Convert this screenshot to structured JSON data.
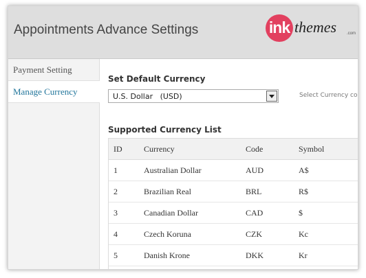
{
  "header": {
    "title": "Appointments Advance Settings",
    "logo": {
      "mark": "ink",
      "word": "themes",
      "suffix": ".com"
    }
  },
  "sidebar": {
    "items": [
      {
        "label": "Payment Setting",
        "active": false
      },
      {
        "label": "Manage Currency",
        "active": true
      }
    ]
  },
  "default_currency": {
    "heading": "Set Default Currency",
    "selected": "U.S. Dollar   (USD)",
    "hint": "Select Currency code."
  },
  "currency_list": {
    "heading": "Supported Currency List",
    "columns": [
      "ID",
      "Currency",
      "Code",
      "Symbol"
    ],
    "rows": [
      [
        "1",
        "Australian Dollar",
        "AUD",
        "A$"
      ],
      [
        "2",
        "Brazilian Real",
        "BRL",
        "R$"
      ],
      [
        "3",
        "Canadian Dollar",
        "CAD",
        "$"
      ],
      [
        "4",
        "Czech Koruna",
        "CZK",
        "Kc"
      ],
      [
        "5",
        "Danish Krone",
        "DKK",
        "Kr"
      ]
    ]
  },
  "colors": {
    "accent": "#21759b",
    "logo": "#e2405f",
    "header_bg": "#dedede"
  }
}
